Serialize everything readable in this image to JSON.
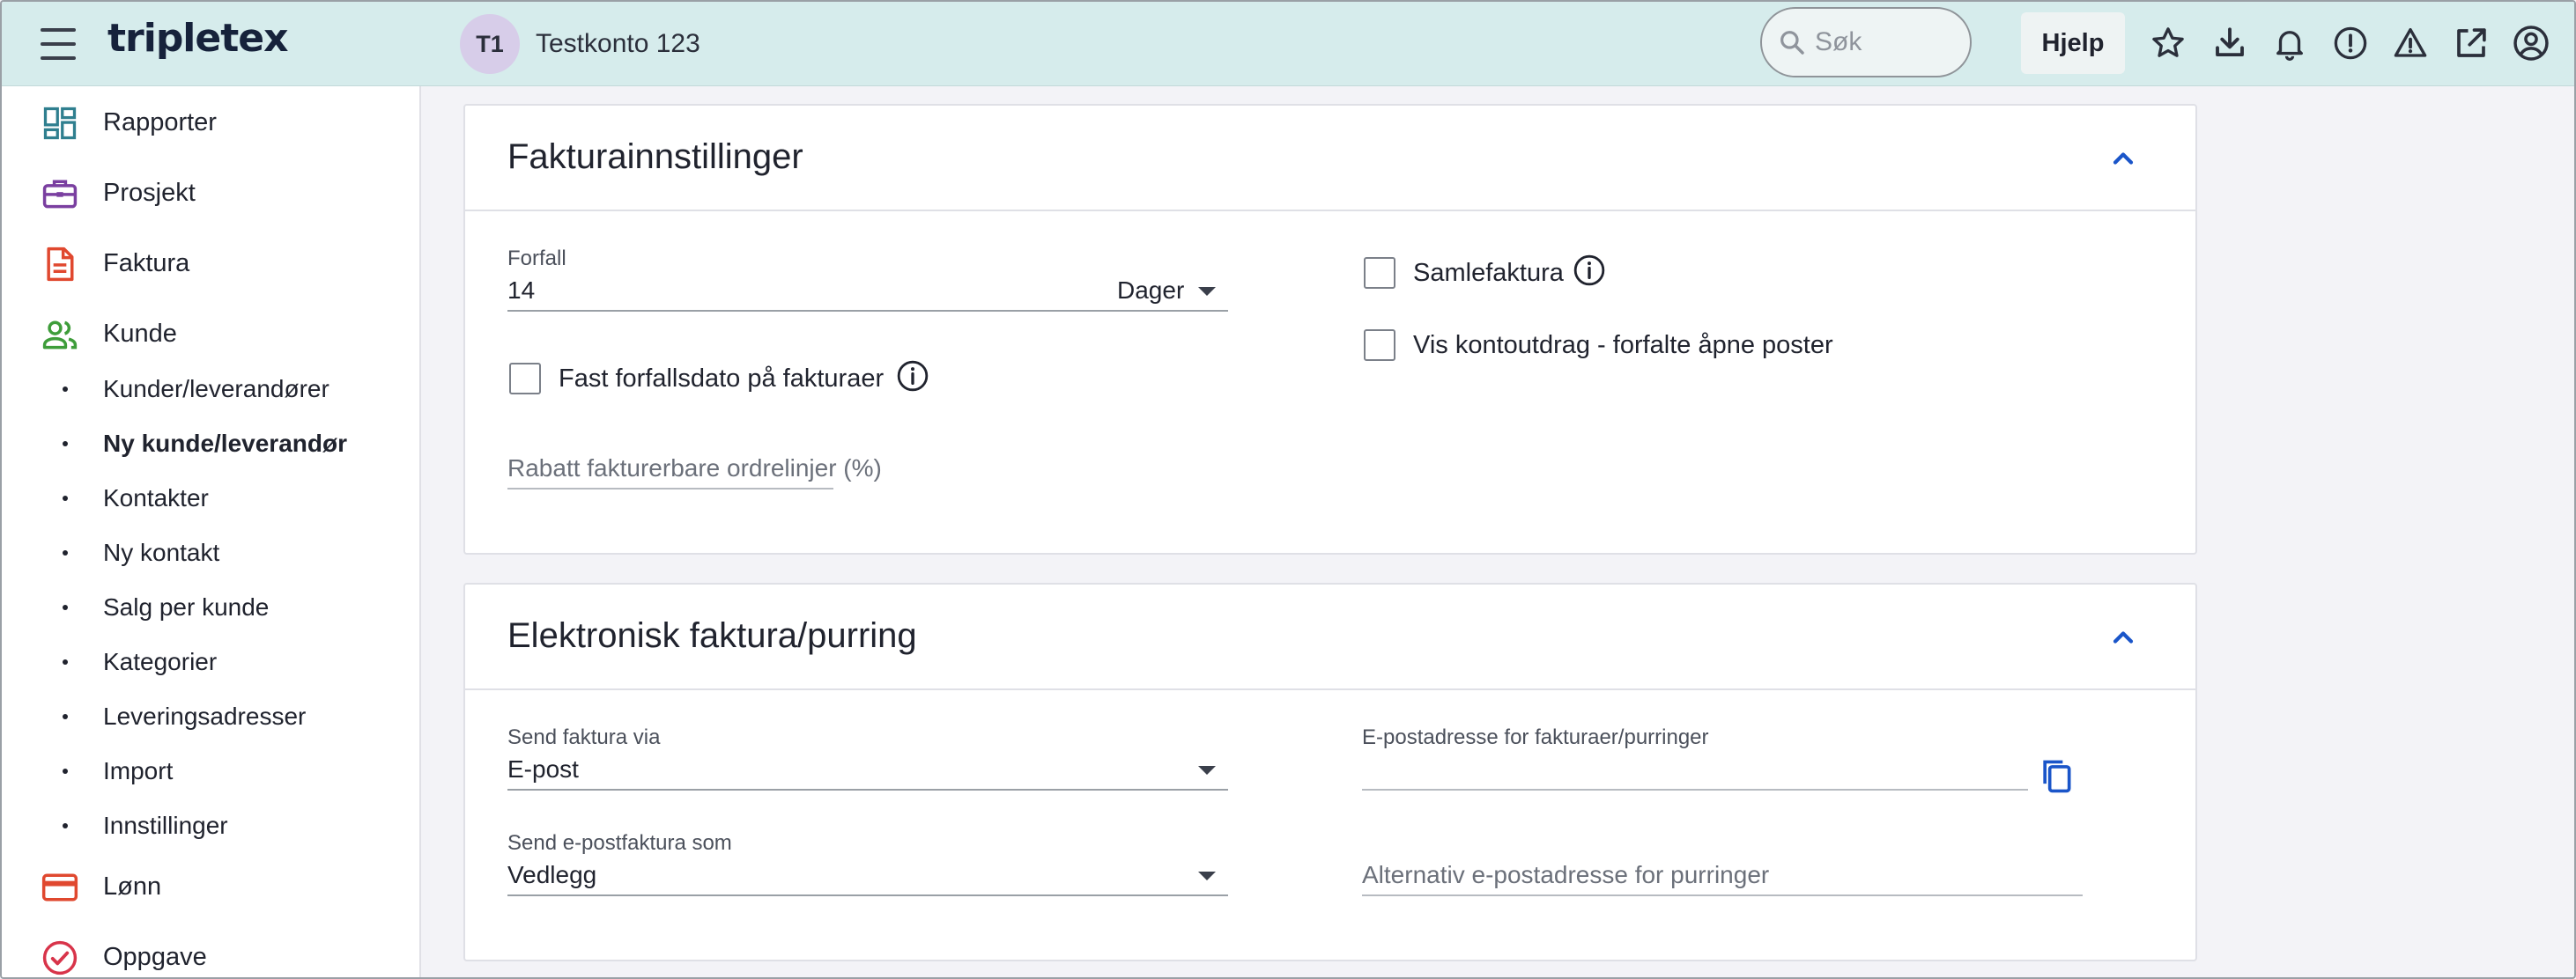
{
  "app": {
    "logo": "tripletex",
    "account": {
      "initials": "T1",
      "name": "Testkonto 123"
    },
    "search_placeholder": "Søk",
    "help_label": "Hjelp"
  },
  "sidebar": {
    "items": [
      {
        "label": "Rapporter",
        "icon": "dashboard-icon",
        "color": "#2f7f8f"
      },
      {
        "label": "Prosjekt",
        "icon": "briefcase-icon",
        "color": "#7a3fa0"
      },
      {
        "label": "Faktura",
        "icon": "document-icon",
        "color": "#e0482f"
      },
      {
        "label": "Kunde",
        "icon": "people-icon",
        "color": "#3e9d3a"
      }
    ],
    "sub_items": [
      {
        "label": "Kunder/leverandører",
        "active": false
      },
      {
        "label": "Ny kunde/leverandør",
        "active": true
      },
      {
        "label": "Kontakter",
        "active": false
      },
      {
        "label": "Ny kontakt",
        "active": false
      },
      {
        "label": "Salg per kunde",
        "active": false
      },
      {
        "label": "Kategorier",
        "active": false
      },
      {
        "label": "Leveringsadresser",
        "active": false
      },
      {
        "label": "Import",
        "active": false
      },
      {
        "label": "Innstillinger",
        "active": false
      }
    ],
    "bottom_items": [
      {
        "label": "Lønn",
        "icon": "card-icon",
        "color": "#e0482f"
      },
      {
        "label": "Oppgave",
        "icon": "check-circle-icon",
        "color": "#d8344a"
      }
    ]
  },
  "invoice_settings": {
    "title": "Fakturainnstillinger",
    "forfall_label": "Forfall",
    "forfall_value": "14",
    "forfall_unit": "Dager",
    "fixed_due_label": "Fast forfallsdato på fakturaer",
    "discount_label": "Rabatt fakturerbare ordrelinjer (%)",
    "collective_label": "Samlefaktura",
    "statement_label": "Vis kontoutdrag - forfalte åpne poster"
  },
  "electronic_invoice": {
    "title": "Elektronisk faktura/purring",
    "send_via_label": "Send faktura via",
    "send_via_value": "E-post",
    "send_as_label": "Send e-postfaktura som",
    "send_as_value": "Vedlegg",
    "email_label": "E-postadresse for fakturaer/purringer",
    "alt_email_placeholder": "Alternativ e-postadresse for purringer"
  },
  "colors": {
    "topbar": "#d6ecec",
    "accent_blue": "#1a55c9"
  }
}
